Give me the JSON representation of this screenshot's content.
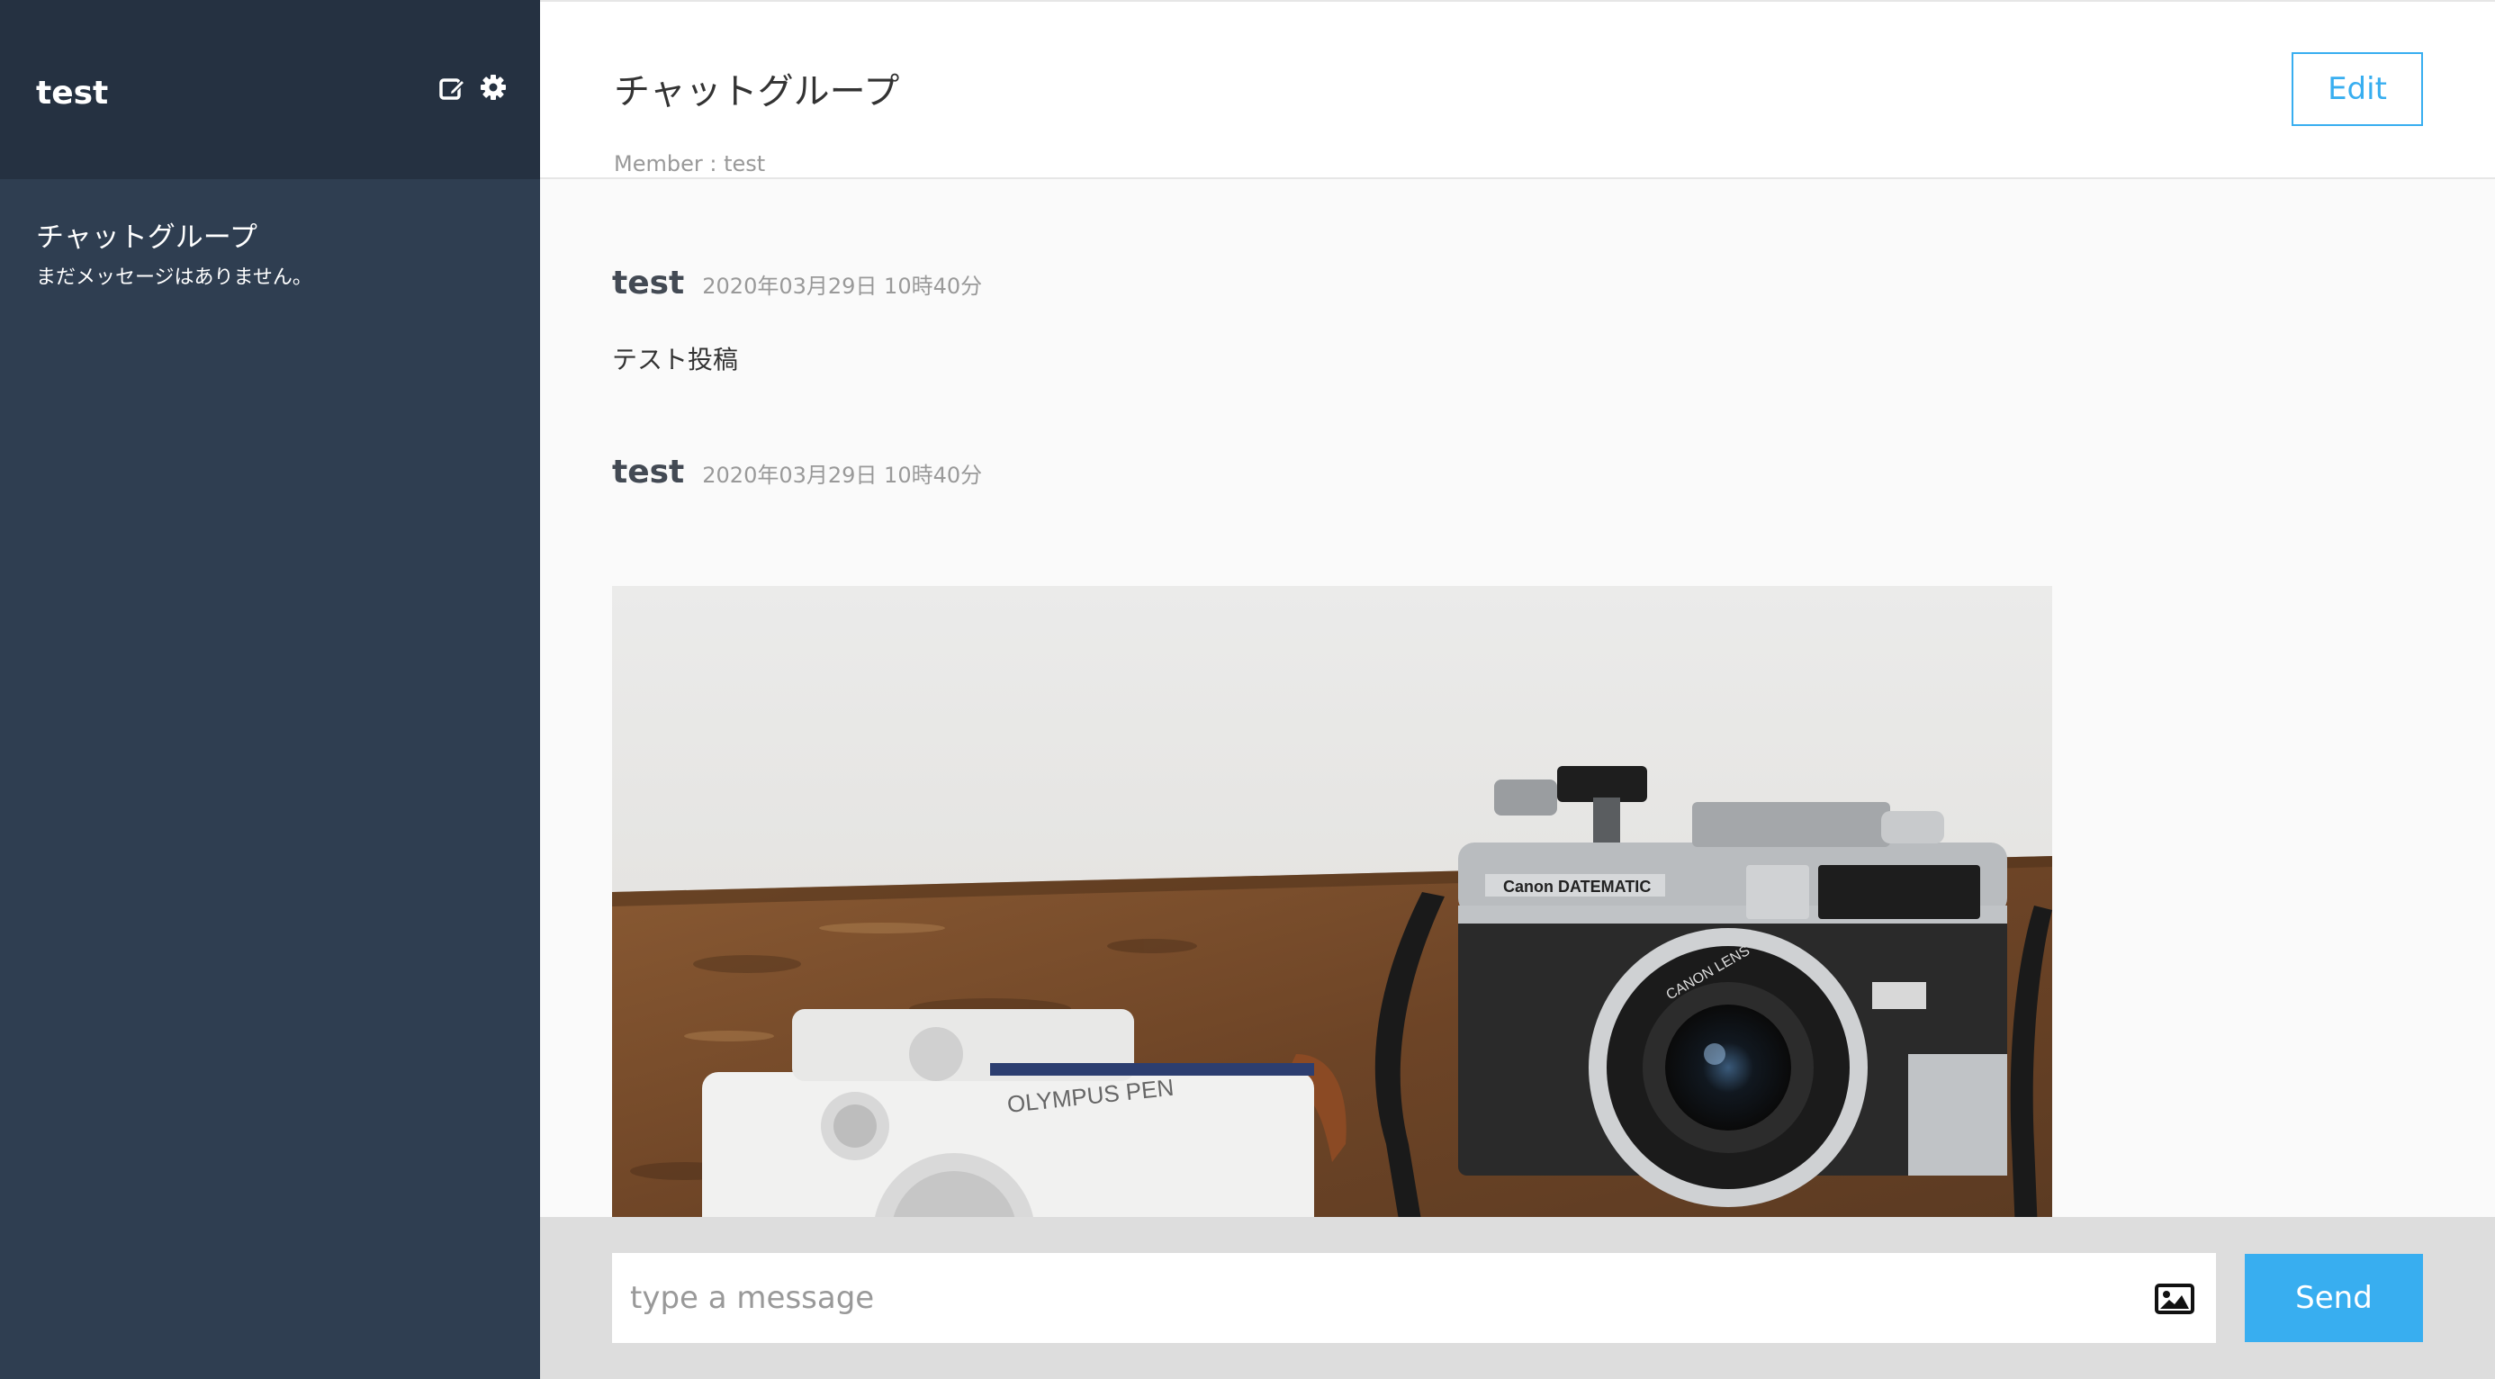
{
  "sidebar": {
    "user_name": "test",
    "icons": [
      "edit-icon",
      "gear-icon"
    ],
    "groups": [
      {
        "name": "チャットグループ",
        "preview": "まだメッセージはありません。"
      }
    ]
  },
  "header": {
    "title": "チャットグループ",
    "member_label": "Member : ",
    "member_names": "test",
    "edit_label": "Edit"
  },
  "messages": [
    {
      "user": "test",
      "date": "2020年03月29日 10時40分",
      "text": "テスト投稿"
    },
    {
      "user": "test",
      "date": "2020年03月29日 10時40分",
      "image": "camera-photo"
    }
  ],
  "form": {
    "placeholder": "type a message",
    "value": "",
    "send_label": "Send",
    "image_icon": "image-icon"
  },
  "colors": {
    "sidebar_bg": "#2f3e51",
    "sidebar_header_bg": "#253141",
    "accent": "#38aef0",
    "form_bg": "#dddddd"
  }
}
